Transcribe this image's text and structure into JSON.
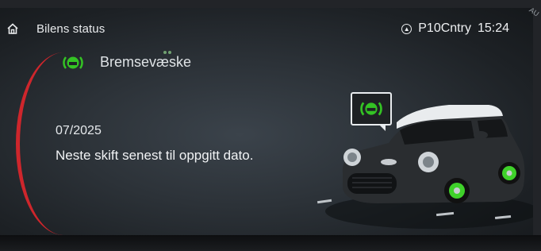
{
  "header": {
    "title": "Bilens status",
    "nav_status": "P10Cntry",
    "time": "15:24"
  },
  "warning": {
    "label": "Bremsevæske",
    "icon": "brake-fluid-warning-icon",
    "color": "#34c324"
  },
  "message": {
    "date": "07/2025",
    "text": "Neste skift senest til oppgitt dato."
  },
  "accent_color": "#d8262c",
  "corner_text": "AU"
}
